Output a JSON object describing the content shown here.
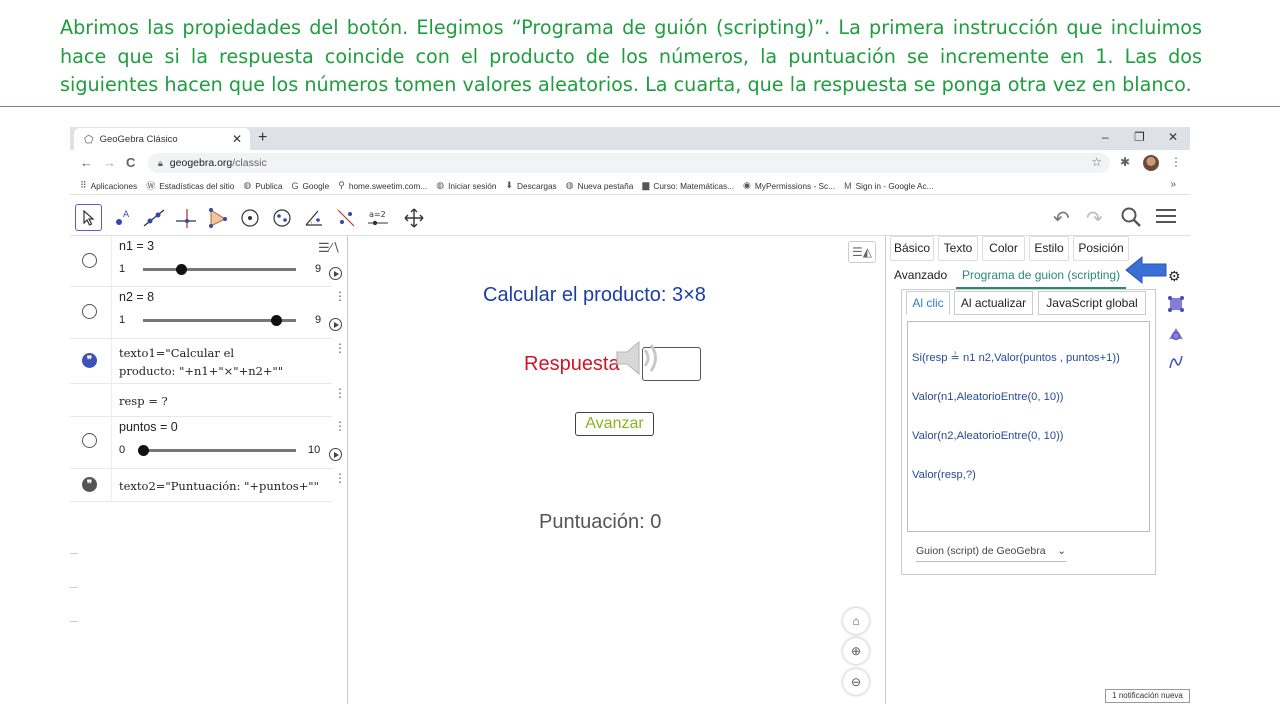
{
  "caption": "Abrimos las propiedades del botón. Elegimos “Programa de guión (scripting)”. La primera instrucción que incluimos hace que si la respuesta coincide con el producto de los números, la puntuación se incremente en 1. Las dos siguientes hacen que los números tomen valores aleatorios. La cuarta, que la respuesta se ponga otra vez en blanco.",
  "browser": {
    "tab_title": "GeoGebra Clásico",
    "tab_close": "✕",
    "new_tab": "+",
    "window_controls": [
      "–",
      "❐",
      "✕"
    ],
    "nav": [
      "←",
      "→",
      "C"
    ],
    "url_domain": "geogebra.org",
    "url_path": "/classic",
    "bookmarks": [
      {
        "icon": "apps-icon",
        "glyph": "⠿",
        "label": "Aplicaciones"
      },
      {
        "icon": "wordpress-icon",
        "glyph": "Ⓦ",
        "label": "Estadísticas del sitio"
      },
      {
        "icon": "globe-icon",
        "glyph": "◍",
        "label": "Publica"
      },
      {
        "icon": "google-icon",
        "glyph": "G",
        "label": "Google"
      },
      {
        "icon": "search-icon",
        "glyph": "⚲",
        "label": "home.sweetim.com..."
      },
      {
        "icon": "globe-icon",
        "glyph": "◍",
        "label": "Iniciar sesión"
      },
      {
        "icon": "download-icon",
        "glyph": "⬇",
        "label": "Descargas"
      },
      {
        "icon": "globe-icon",
        "glyph": "◍",
        "label": "Nueva pestaña"
      },
      {
        "icon": "course-icon",
        "glyph": "▆",
        "label": "Curso: Matemáticas..."
      },
      {
        "icon": "permissions-icon",
        "glyph": "◉",
        "label": "MyPermissions - Sc..."
      },
      {
        "icon": "gmail-icon",
        "glyph": "M",
        "label": "Sign in - Google Ac..."
      }
    ],
    "bookmarks_more": "»"
  },
  "algebra": {
    "n1_label": "n1 = 3",
    "n1_min": "1",
    "n1_max": "9",
    "n1_fraction": 0.25,
    "n2_label": "n2 = 8",
    "n2_min": "1",
    "n2_max": "9",
    "n2_fraction": 0.875,
    "texto1_line1": "texto1=\"Calcular el",
    "texto1_line2": "producto: \"+n1+\"×\"+n2+\"\"",
    "resp_label": "resp = ?",
    "puntos_label": "puntos = 0",
    "puntos_min": "0",
    "puntos_max": "10",
    "puntos_fraction": 0.0,
    "texto2_label": "texto2=\"Puntuación: \"+puntos+\"\"",
    "menu_glyph": "⋮",
    "quote_glyph": "❞"
  },
  "graphics": {
    "title": "Calcular el producto: 3×8",
    "respuesta_label": "Respuesta",
    "avanzar_button": "Avanzar",
    "score": "Puntuación: 0",
    "home_glyph": "⌂",
    "zoom_in_glyph": "⊕",
    "zoom_out_glyph": "⊖"
  },
  "properties": {
    "tabs_row1": [
      "Básico",
      "Texto",
      "Color",
      "Estilo",
      "Posición"
    ],
    "tabs_row2": [
      "Avanzado",
      "Programa de guion (scripting)"
    ],
    "close": "✕",
    "subtabs": [
      "Al clic",
      "Al actualizar",
      "JavaScript global"
    ],
    "script_lines": [
      "Si(resp ≟ n1 n2,Valor(puntos , puntos+1))",
      "Valor(n1,AleatorioEntre(0, 10))",
      "Valor(n2,AleatorioEntre(0, 10))",
      "Valor(resp,?)"
    ],
    "script_type": "Guion (script) de GeoGebra",
    "script_type_arrow": "⌄"
  },
  "notification": "1 notificación nueva",
  "colors": {
    "caption": "#1e9e3e",
    "title_blue": "#1a3ea8",
    "respuesta_red": "#d0142a",
    "avanzar_green": "#8ab51a",
    "selected_tab": "#2b8a74",
    "arrow": "#3a6fd8"
  }
}
